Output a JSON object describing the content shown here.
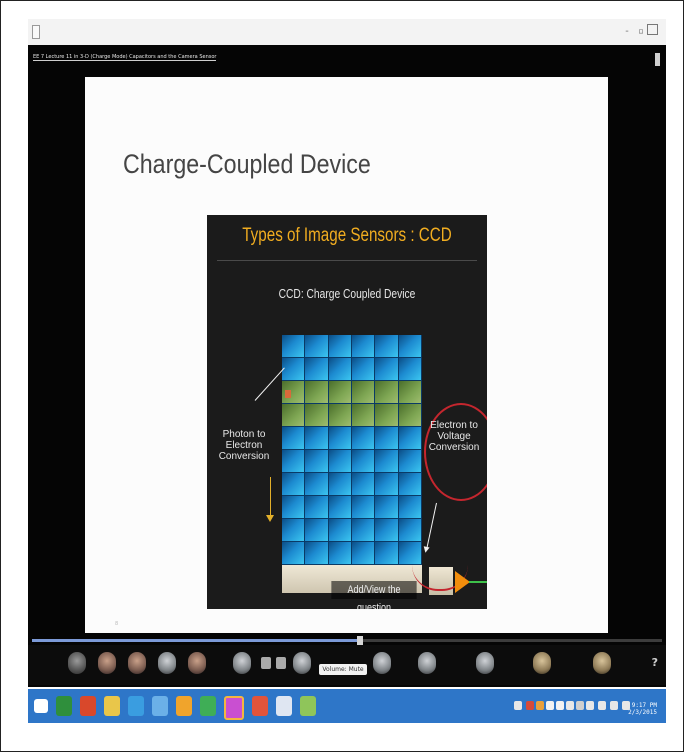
{
  "window": {
    "title_bar_text": "",
    "controls": "- ▫"
  },
  "video": {
    "title": "EE 7 Lecture 11 in 3-D (Charge Mode) Capacitors and the Camera Sensor"
  },
  "slide": {
    "title": "Charge-Coupled Device",
    "panel_title": "Types of Image Sensors : CCD",
    "panel_subtitle": "CCD: Charge Coupled Device",
    "label_left": "Photon to\nElectron\nConversion",
    "label_right": "Electron to\nVoltage\nConversion",
    "overlay_caption": "Add/View the question",
    "footer": "8"
  },
  "player": {
    "progress_fraction": 0.52,
    "tooltip": "Volume: Mute",
    "help_label": "?"
  },
  "taskbar": {
    "clock_time": "9:17 PM",
    "clock_date": "2/3/2015"
  },
  "colors": {
    "accent_orange": "#f1ad20",
    "annotation_red": "#c4262e",
    "taskbar_blue": "#2e76c8"
  }
}
